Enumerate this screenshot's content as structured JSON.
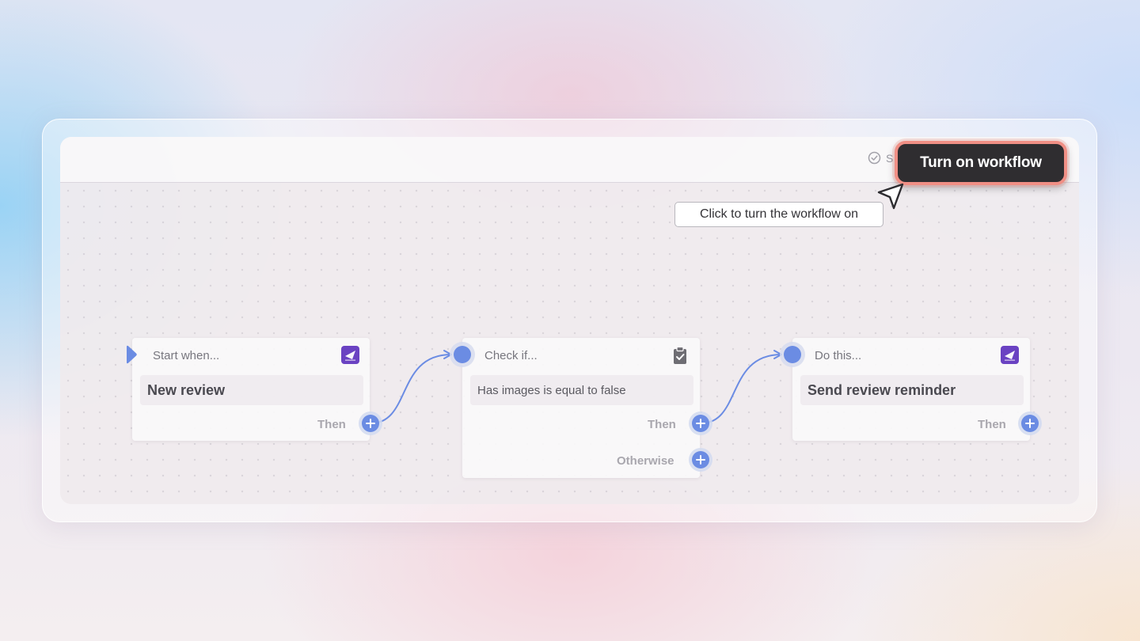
{
  "topbar": {
    "status_text": "S",
    "turn_on_label": "Turn on workflow"
  },
  "tooltip": {
    "text": "Click to turn the workflow on"
  },
  "nodes": [
    {
      "header": "Start when...",
      "body": "New review",
      "then_label": "Then",
      "icon": "app-logo-icon"
    },
    {
      "header": "Check if...",
      "body": "Has images is equal to false",
      "then_label": "Then",
      "otherwise_label": "Otherwise",
      "icon": "clipboard-check-icon"
    },
    {
      "header": "Do this...",
      "body": "Send review reminder",
      "then_label": "Then",
      "icon": "app-logo-icon"
    }
  ],
  "colors": {
    "accent_blue": "#6b8ce3",
    "button_dark": "#2f2d30",
    "button_highlight": "#f08f85",
    "app_badge": "#6a42c2"
  }
}
